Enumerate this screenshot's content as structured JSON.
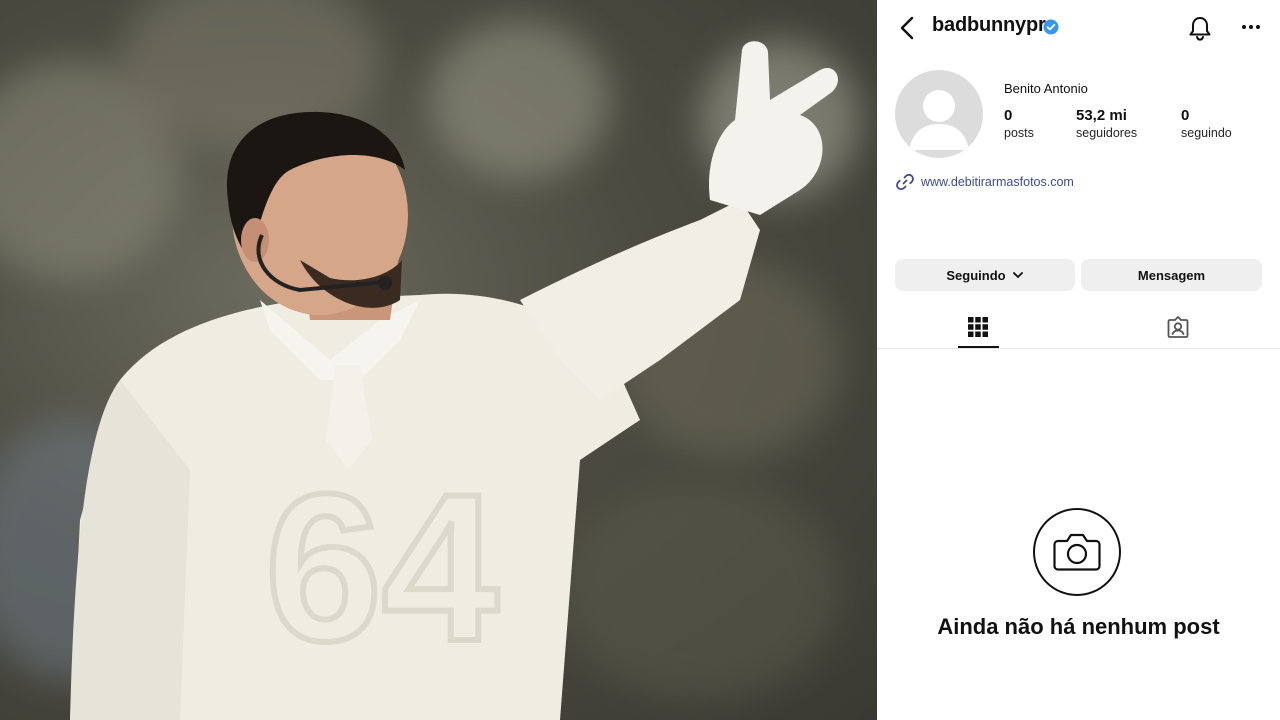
{
  "profile": {
    "username": "badbunnypr",
    "full_name": "Benito Antonio",
    "website": "www.debitirarmasfotos.com",
    "stats": [
      {
        "value": "0",
        "label": "posts"
      },
      {
        "value": "53,2 mi",
        "label": "seguidores"
      },
      {
        "value": "0",
        "label": "seguindo"
      }
    ]
  },
  "actions": {
    "following_label": "Seguindo",
    "message_label": "Mensagem"
  },
  "tabs": [
    {
      "icon": "grid-icon",
      "active": true
    },
    {
      "icon": "tagged-icon",
      "active": false
    }
  ],
  "empty_state": {
    "icon": "camera-icon",
    "text": "Ainda não há nenhum post"
  },
  "colors": {
    "verified": "#3797f0",
    "link": "#3a4d8f",
    "button_bg": "#efefef"
  }
}
